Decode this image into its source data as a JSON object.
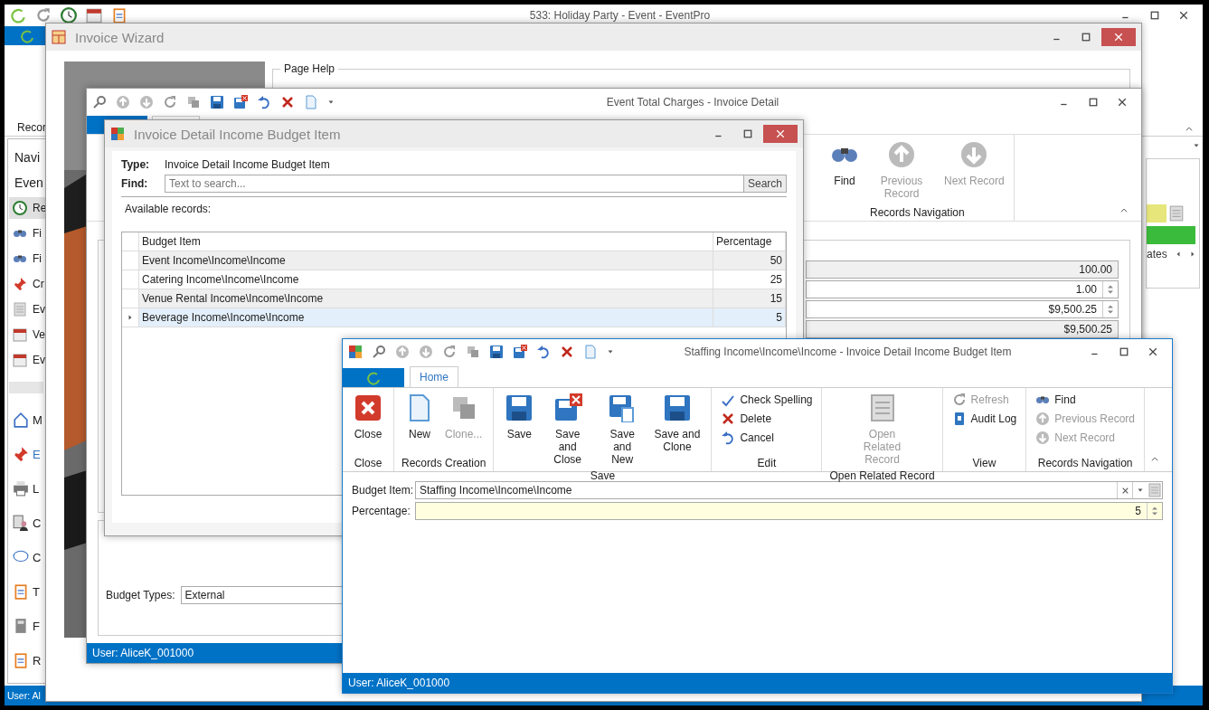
{
  "main_window": {
    "title": "533: Holiday Party - Event - EventPro",
    "ribbon_label": "Recor",
    "nav_title": "Navi",
    "nav_section": "Even",
    "nav_items": [
      {
        "label": "Re",
        "selected": true
      },
      {
        "label": "Fi",
        "selected": false
      },
      {
        "label": "Fi",
        "selected": false
      },
      {
        "label": "Cr",
        "selected": false
      },
      {
        "label": "Ev",
        "selected": false
      },
      {
        "label": "Ve",
        "selected": false
      },
      {
        "label": "Ev",
        "selected": false
      }
    ],
    "nav_modules": [
      {
        "label": "M",
        "selected": false
      },
      {
        "label": "E",
        "selected": true
      },
      {
        "label": "L",
        "selected": false
      },
      {
        "label": "C",
        "selected": false
      },
      {
        "label": "C",
        "selected": false
      },
      {
        "label": "T",
        "selected": false
      },
      {
        "label": "F",
        "selected": false
      },
      {
        "label": "R",
        "selected": false
      }
    ],
    "side_tab": "ates",
    "status": "User: Al"
  },
  "wizard": {
    "title": "Invoice Wizard",
    "page_help": "Page Help"
  },
  "charges_window": {
    "title": "Event Total Charges - Invoice Detail",
    "ribbon_buttons": [
      {
        "label": "Find",
        "disabled": false
      },
      {
        "label": "Previous Record",
        "disabled": true
      },
      {
        "label": "Next Record",
        "disabled": true
      }
    ],
    "ribbon_group": "Records Navigation",
    "fields": [
      {
        "kind": "readonly",
        "value": "100.00"
      },
      {
        "kind": "spin",
        "value": "1.00"
      },
      {
        "kind": "spin",
        "value": "$9,500.25"
      },
      {
        "kind": "readonly",
        "value": "$9,500.25"
      }
    ],
    "budget_types_label": "Budget Types:",
    "budget_types_value": "External",
    "status": "User: AliceK_001000"
  },
  "lookup_window": {
    "title": "Invoice Detail Income Budget Item",
    "type_label": "Type:",
    "type_value": "Invoice Detail Income Budget Item",
    "find_label": "Find:",
    "find_placeholder": "Text to search...",
    "search_button": "Search",
    "available_label": "Available records:",
    "columns": [
      "Budget Item",
      "Percentage"
    ],
    "rows": [
      {
        "cells": [
          "Event Income\\Income\\Income",
          "50"
        ],
        "selected": false
      },
      {
        "cells": [
          "Catering Income\\Income\\Income",
          "25"
        ],
        "selected": false
      },
      {
        "cells": [
          "Venue Rental Income\\Income\\Income",
          "15"
        ],
        "selected": false
      },
      {
        "cells": [
          "Beverage Income\\Income\\Income",
          "5"
        ],
        "selected": true
      }
    ]
  },
  "record_window": {
    "title": "Staffing Income\\Income\\Income - Invoice Detail Income Budget Item",
    "tabs": [
      {
        "label": "Home",
        "selected": true
      }
    ],
    "groups": [
      {
        "label": "Close",
        "kind": "large",
        "items": [
          {
            "label": "Close",
            "disabled": false
          }
        ]
      },
      {
        "label": "Records Creation",
        "kind": "large",
        "items": [
          {
            "label": "New",
            "disabled": false
          },
          {
            "label": "Clone...",
            "disabled": true
          }
        ]
      },
      {
        "label": "Save",
        "kind": "large",
        "items": [
          {
            "label": "Save",
            "disabled": false
          },
          {
            "label": "Save and Close",
            "disabled": false
          },
          {
            "label": "Save and New",
            "disabled": false
          },
          {
            "label": "Save and Clone",
            "disabled": false
          }
        ]
      },
      {
        "label": "Edit",
        "kind": "small",
        "items": [
          {
            "label": "Check Spelling",
            "disabled": false
          },
          {
            "label": "Delete",
            "disabled": false
          },
          {
            "label": "Cancel",
            "disabled": false
          }
        ]
      },
      {
        "label": "Open Related Record",
        "kind": "large",
        "items": [
          {
            "label": "Open Related Record",
            "disabled": true
          }
        ]
      },
      {
        "label": "View",
        "kind": "small",
        "items": [
          {
            "label": "Refresh",
            "disabled": true
          },
          {
            "label": "Audit Log",
            "disabled": false
          }
        ]
      },
      {
        "label": "Records Navigation",
        "kind": "small",
        "items": [
          {
            "label": "Find",
            "disabled": false
          },
          {
            "label": "Previous Record",
            "disabled": true
          },
          {
            "label": "Next Record",
            "disabled": true
          }
        ]
      }
    ],
    "fields": [
      {
        "label": "Budget Item:",
        "value": "Staffing Income\\Income\\Income",
        "kind": "combo"
      },
      {
        "label": "Percentage:",
        "value": "5",
        "kind": "spin"
      }
    ],
    "status": "User: AliceK_001000"
  }
}
